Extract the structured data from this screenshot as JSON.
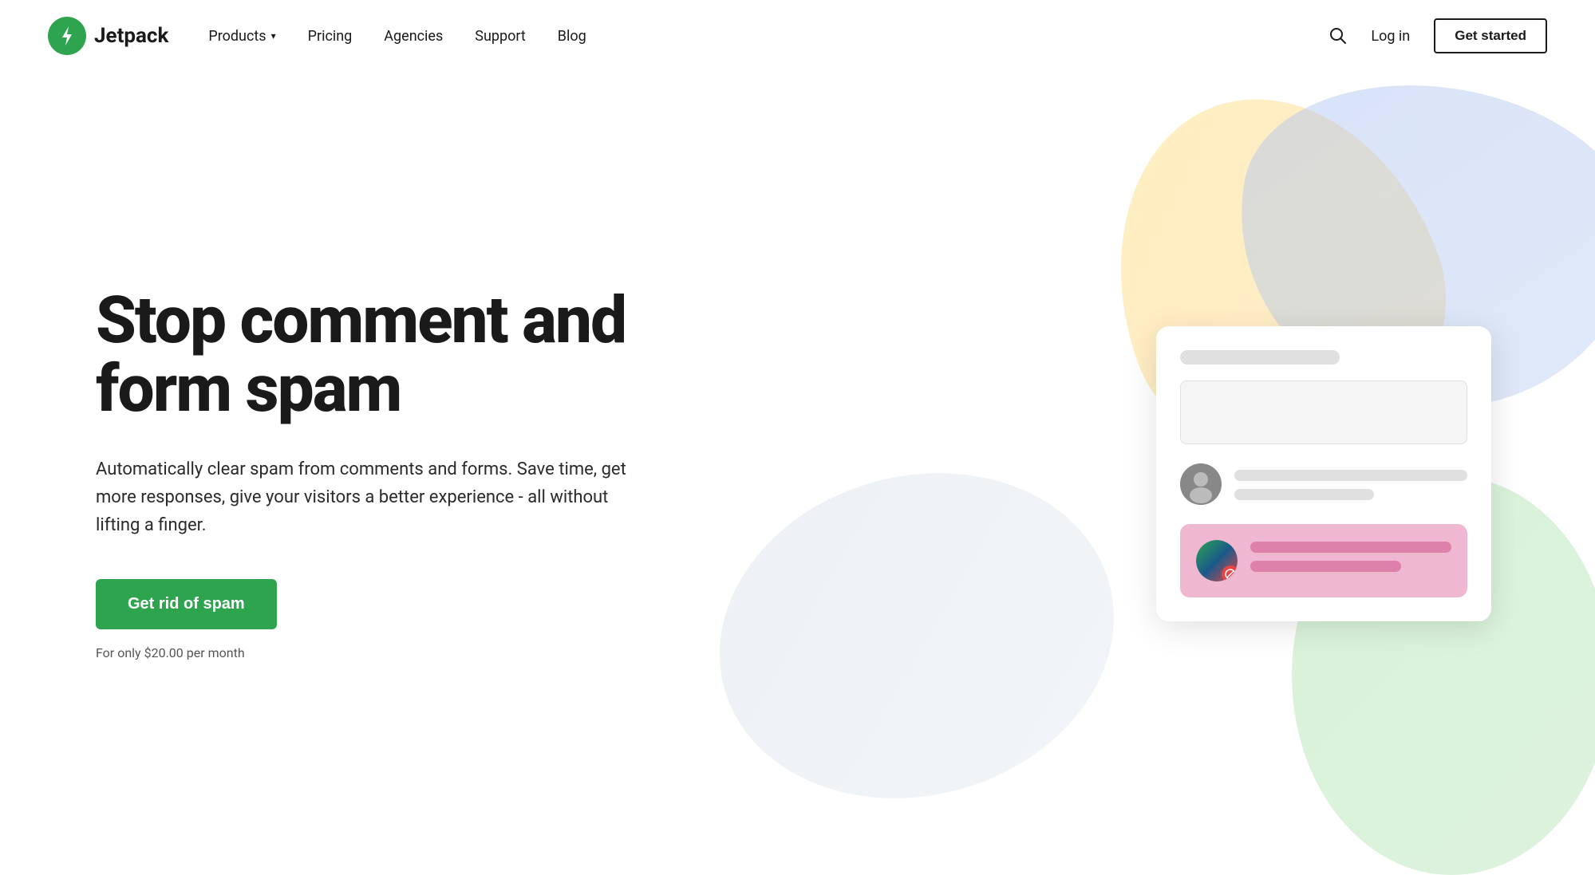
{
  "header": {
    "logo_text": "Jetpack",
    "nav": {
      "products_label": "Products",
      "pricing_label": "Pricing",
      "agencies_label": "Agencies",
      "support_label": "Support",
      "blog_label": "Blog"
    },
    "login_label": "Log in",
    "get_started_label": "Get started"
  },
  "hero": {
    "title": "Stop comment and form spam",
    "description": "Automatically clear spam from comments and forms. Save time, get more responses, give your visitors a better experience - all without lifting a finger.",
    "cta_label": "Get rid of spam",
    "price_note": "For only $20.00 per month"
  },
  "icons": {
    "logo_bolt": "⚡",
    "search": "🔍",
    "chevron_down": "▾"
  }
}
